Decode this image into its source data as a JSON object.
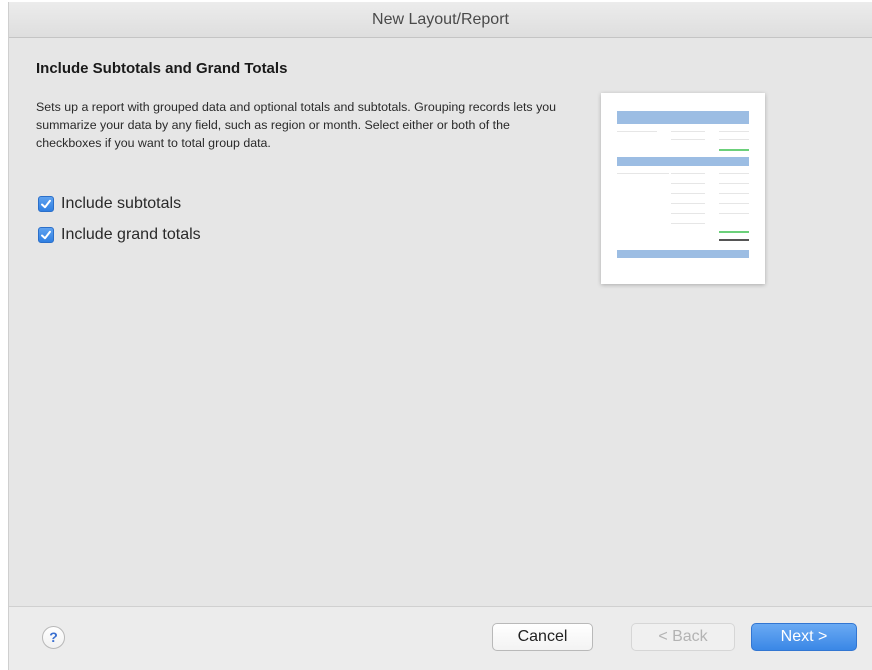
{
  "window": {
    "title": "New Layout/Report"
  },
  "content": {
    "heading": "Include Subtotals and Grand Totals",
    "description": "Sets up a report with grouped data and optional totals and subtotals. Grouping records lets you summarize your data by any field, such as region or month. Select either or both of the checkboxes if you want to total group data.",
    "options": [
      {
        "label": "Include subtotals",
        "checked": true
      },
      {
        "label": "Include grand totals",
        "checked": true
      }
    ]
  },
  "footer": {
    "help_label": "?",
    "cancel_label": "Cancel",
    "back_label": "< Back",
    "next_label": "Next >"
  },
  "colors": {
    "accent": "#3a87e6",
    "preview_bar": "#9cbde3",
    "preview_total": "#6bd07a"
  }
}
